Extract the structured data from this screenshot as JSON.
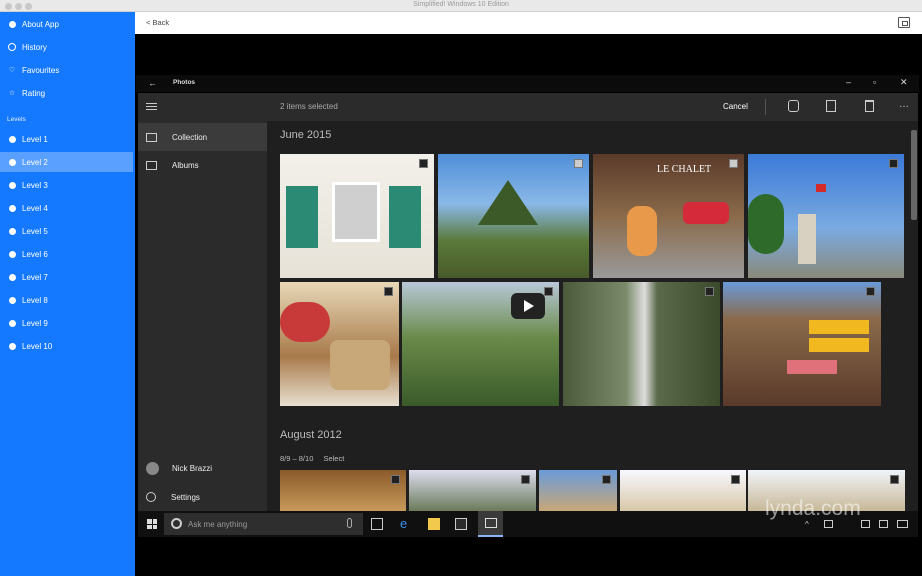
{
  "window": {
    "title": "Simplified! Windows 10 Edition"
  },
  "sidebar": {
    "items": [
      {
        "label": "About App",
        "icon": "info-icon"
      },
      {
        "label": "History",
        "icon": "clock-icon"
      },
      {
        "label": "Favourites",
        "icon": "heart-icon"
      },
      {
        "label": "Rating",
        "icon": "star-icon"
      }
    ],
    "section_label": "Levels",
    "levels": [
      "Level 1",
      "Level 2",
      "Level 3",
      "Level 4",
      "Level 5",
      "Level 6",
      "Level 7",
      "Level 8",
      "Level 9",
      "Level 10"
    ],
    "active_level": "Level 2"
  },
  "nav": {
    "back_label": "< Back"
  },
  "photos_app": {
    "title": "Photos",
    "nav_items": [
      "Collection",
      "Albums"
    ],
    "user_name": "Nick Brazzi",
    "settings_label": "Settings",
    "selection_status": "2 items selected",
    "cancel_label": "Cancel",
    "sections": [
      {
        "title": "June 2015"
      },
      {
        "title": "August 2012",
        "sub": "8/9 – 8/10",
        "select_label": "Select"
      }
    ],
    "search_placeholder": "Ask me anything"
  },
  "watermark": "lynda.com"
}
